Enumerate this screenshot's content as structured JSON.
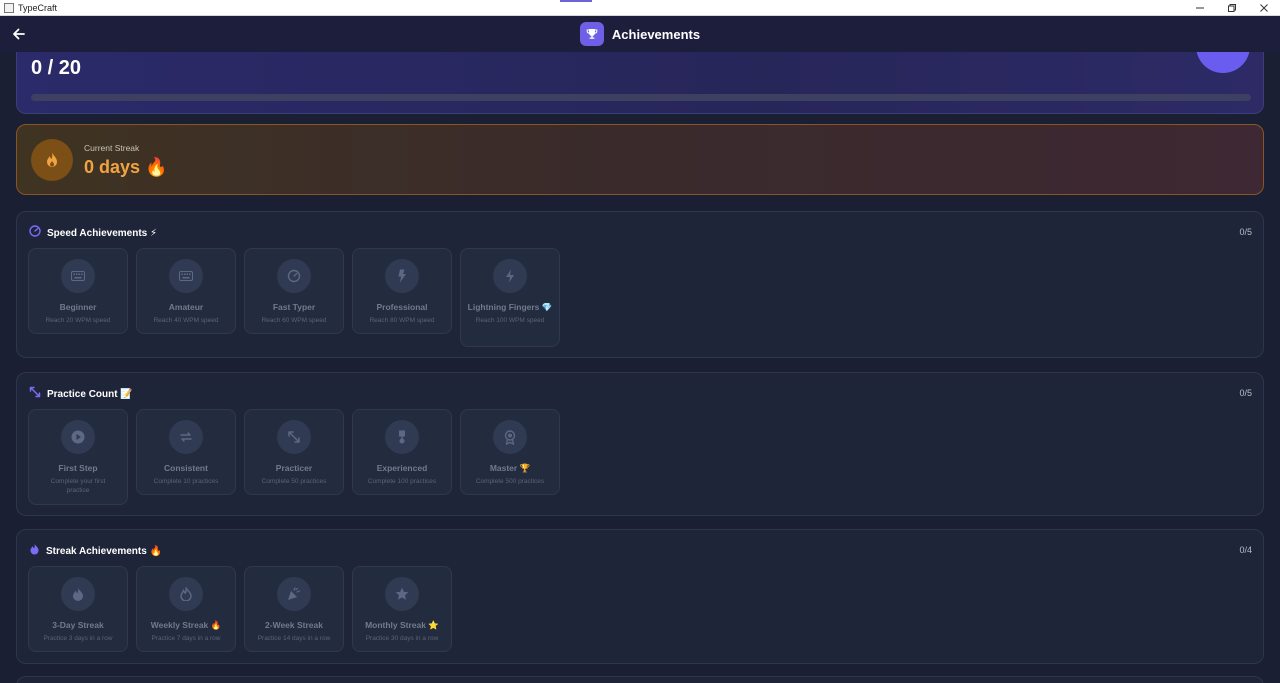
{
  "window": {
    "title": "TypeCraft"
  },
  "header": {
    "title": "Achievements"
  },
  "progress": {
    "count": "0 / 20",
    "percent": "0%",
    "fill_fraction": 0
  },
  "streak": {
    "label": "Current Streak",
    "value": "0 days 🔥"
  },
  "sections": [
    {
      "title": "Speed Achievements ⚡",
      "count": "0/5",
      "items": [
        {
          "name": "Beginner",
          "desc": "Reach 20 WPM speed",
          "icon": "keyboard-icon"
        },
        {
          "name": "Amateur",
          "desc": "Reach 40 WPM speed",
          "icon": "keyboard-icon"
        },
        {
          "name": "Fast Typer",
          "desc": "Reach 60 WPM speed",
          "icon": "speedometer-icon"
        },
        {
          "name": "Professional",
          "desc": "Reach 80 WPM speed",
          "icon": "bolt-icon"
        },
        {
          "name": "Lightning Fingers 💎",
          "desc": "Reach 100 WPM speed",
          "icon": "bolt-icon"
        }
      ]
    },
    {
      "title": "Practice Count 📝",
      "count": "0/5",
      "items": [
        {
          "name": "First Step",
          "desc": "Complete your first practice",
          "icon": "play-icon"
        },
        {
          "name": "Consistent",
          "desc": "Complete 10 practices",
          "icon": "repeat-icon"
        },
        {
          "name": "Practicer",
          "desc": "Complete 50 practices",
          "icon": "expand-arrows-icon"
        },
        {
          "name": "Experienced",
          "desc": "Complete 100 practices",
          "icon": "medal-icon"
        },
        {
          "name": "Master 🏆",
          "desc": "Complete 500 practices",
          "icon": "award-icon"
        }
      ]
    },
    {
      "title": "Streak Achievements 🔥",
      "count": "0/4",
      "items": [
        {
          "name": "3-Day Streak",
          "desc": "Practice 3 days in a row",
          "icon": "flame-icon"
        },
        {
          "name": "Weekly Streak 🔥",
          "desc": "Practice 7 days in a row",
          "icon": "fire-icon"
        },
        {
          "name": "2-Week Streak",
          "desc": "Practice 14 days in a row",
          "icon": "party-icon"
        },
        {
          "name": "Monthly Streak ⭐",
          "desc": "Practice 30 days in a row",
          "icon": "star-icon"
        }
      ]
    }
  ],
  "colors": {
    "accent": "#6f5ee6",
    "streak": "#f2a341",
    "background": "#1b1f33"
  }
}
